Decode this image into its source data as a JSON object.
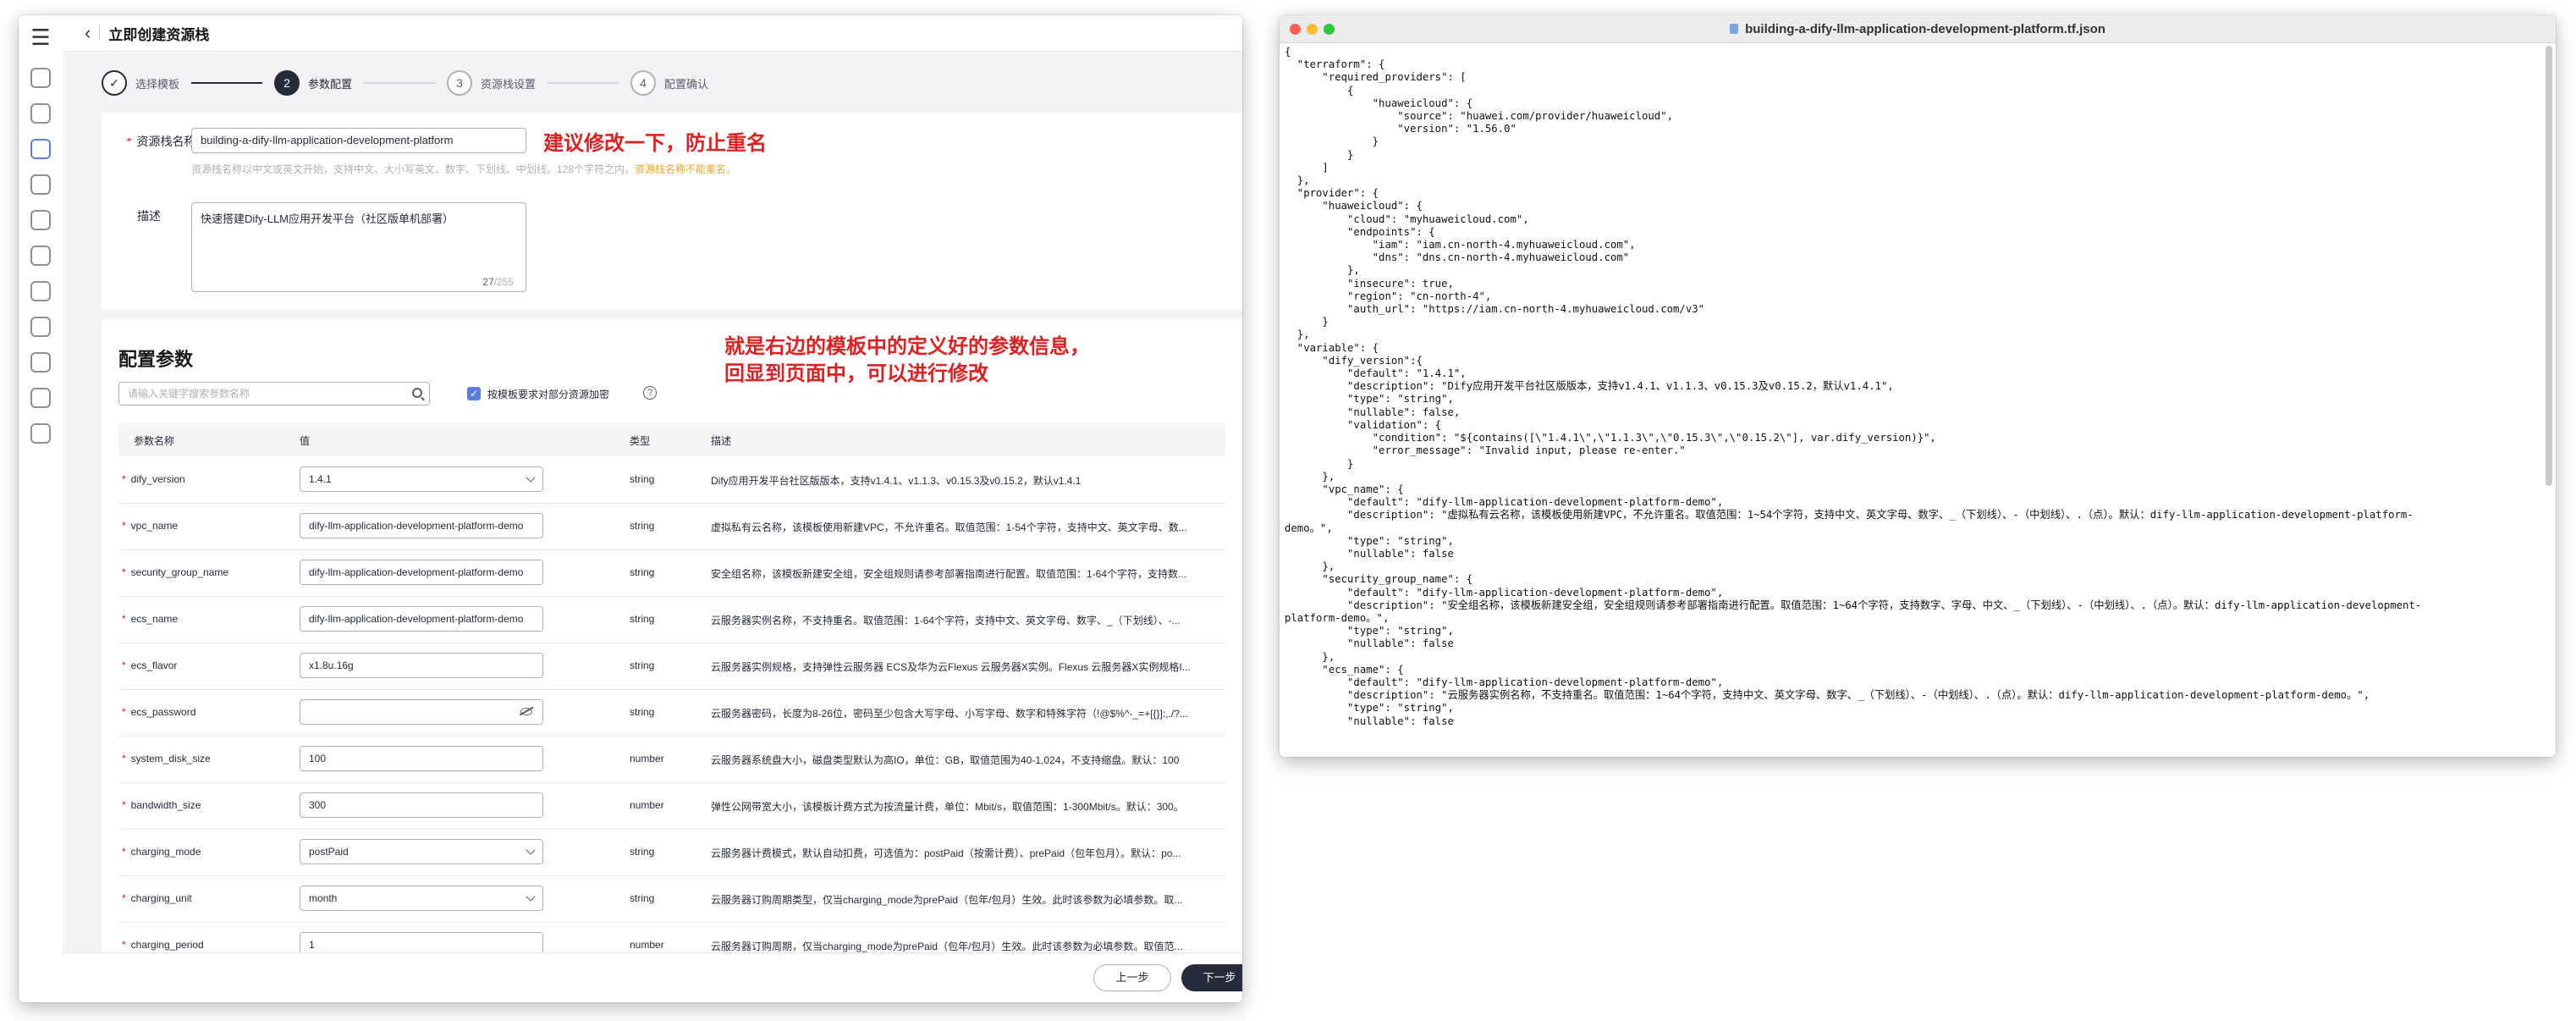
{
  "left_window": {
    "header": {
      "title": "立即创建资源栈"
    },
    "steps": [
      {
        "num": "",
        "label": "选择模板"
      },
      {
        "num": "2",
        "label": "参数配置"
      },
      {
        "num": "3",
        "label": "资源栈设置"
      },
      {
        "num": "4",
        "label": "配置确认"
      }
    ],
    "stack_name": {
      "label": "资源栈名称",
      "value": "building-a-dify-llm-application-development-platform",
      "hint": "资源栈名称以中文或英文开始，支持中文、大小写英文、数字、下划线、中划线。128个字符之内。",
      "hint_warn": "资源栈名称不能重名。"
    },
    "description": {
      "label": "描述",
      "value": "快速搭建Dify-LLM应用开发平台（社区版单机部署）",
      "count": "27",
      "total": "/255"
    },
    "annotation_top": "建议修改一下，防止重名",
    "annotation_mid_1": "就是右边的模板中的定义好的参数信息，",
    "annotation_mid_2": "回显到页面中，可以进行修改",
    "config": {
      "title": "配置参数",
      "search_placeholder": "请输入关键字搜索参数名称",
      "encrypt_label": "按模板要求对部分资源加密"
    },
    "table": {
      "headers": [
        "参数名称",
        "值",
        "类型",
        "描述"
      ],
      "rows": [
        {
          "name": "dify_version",
          "value": "1.4.1",
          "control": "select",
          "type": "string",
          "desc": "Dify应用开发平台社区版版本，支持v1.4.1、v1.1.3、v0.15.3及v0.15.2，默认v1.4.1"
        },
        {
          "name": "vpc_name",
          "value": "dify-llm-application-development-platform-demo",
          "control": "text",
          "type": "string",
          "desc": "虚拟私有云名称，该模板使用新建VPC，不允许重名。取值范围：1-54个字符，支持中文、英文字母、数..."
        },
        {
          "name": "security_group_name",
          "value": "dify-llm-application-development-platform-demo",
          "control": "text",
          "type": "string",
          "desc": "安全组名称，该模板新建安全组，安全组规则请参考部署指南进行配置。取值范围：1-64个字符，支持数..."
        },
        {
          "name": "ecs_name",
          "value": "dify-llm-application-development-platform-demo",
          "control": "text",
          "type": "string",
          "desc": "云服务器实例名称，不支持重名。取值范围：1-64个字符，支持中文、英文字母、数字、_（下划线）、-..."
        },
        {
          "name": "ecs_flavor",
          "value": "x1.8u.16g",
          "control": "text",
          "type": "string",
          "desc": "云服务器实例规格，支持弹性云服务器 ECS及华为云Flexus 云服务器X实例。Flexus 云服务器X实例规格I..."
        },
        {
          "name": "ecs_password",
          "value": "",
          "control": "password",
          "type": "string",
          "desc": "云服务器密码，长度为8-26位，密码至少包含大写字母、小写字母、数字和特殊字符（!@$%^-_=+[{}]:,./?..."
        },
        {
          "name": "system_disk_size",
          "value": "100",
          "control": "text",
          "type": "number",
          "desc": "云服务器系统盘大小，磁盘类型默认为高IO，单位：GB，取值范围为40-1,024，不支持缩盘。默认：100"
        },
        {
          "name": "bandwidth_size",
          "value": "300",
          "control": "text",
          "type": "number",
          "desc": "弹性公网带宽大小，该模板计费方式为按流量计费，单位：Mbit/s，取值范围：1-300Mbit/s。默认：300。"
        },
        {
          "name": "charging_mode",
          "value": "postPaid",
          "control": "select",
          "type": "string",
          "desc": "云服务器计费模式，默认自动扣费，可选值为：postPaid（按需计费）、prePaid（包年包月）。默认：po..."
        },
        {
          "name": "charging_unit",
          "value": "month",
          "control": "select",
          "type": "string",
          "desc": "云服务器订购周期类型，仅当charging_mode为prePaid（包年/包月）生效。此时该参数为必填参数。取..."
        },
        {
          "name": "charging_period",
          "value": "1",
          "control": "text",
          "type": "number",
          "desc": "云服务器订购周期，仅当charging_mode为prePaid（包年/包月）生效。此时该参数为必填参数。取值范..."
        }
      ]
    },
    "footer": {
      "prev_label": "上一步",
      "next_label": "下一步"
    }
  },
  "right_window": {
    "filename": "building-a-dify-llm-application-development-platform.tf.json",
    "code": "{\n  \"terraform\": {\n      \"required_providers\": [\n          {\n              \"huaweicloud\": {\n                  \"source\": \"huawei.com/provider/huaweicloud\",\n                  \"version\": \"1.56.0\"\n              }\n          }\n      ]\n  },\n  \"provider\": {\n      \"huaweicloud\": {\n          \"cloud\": \"myhuaweicloud.com\",\n          \"endpoints\": {\n              \"iam\": \"iam.cn-north-4.myhuaweicloud.com\",\n              \"dns\": \"dns.cn-north-4.myhuaweicloud.com\"\n          },\n          \"insecure\": true,\n          \"region\": \"cn-north-4\",\n          \"auth_url\": \"https://iam.cn-north-4.myhuaweicloud.com/v3\"\n      }\n  },\n  \"variable\": {\n      \"dify_version\":{\n          \"default\": \"1.4.1\",\n          \"description\": \"Dify应用开发平台社区版版本，支持v1.4.1、v1.1.3、v0.15.3及v0.15.2，默认v1.4.1\",\n          \"type\": \"string\",\n          \"nullable\": false,\n          \"validation\": {\n              \"condition\": \"${contains([\\\"1.4.1\\\",\\\"1.1.3\\\",\\\"0.15.3\\\",\\\"0.15.2\\\"], var.dify_version)}\",\n              \"error_message\": \"Invalid input, please re-enter.\"\n          }\n      },\n      \"vpc_name\": {\n          \"default\": \"dify-llm-application-development-platform-demo\",\n          \"description\": \"虚拟私有云名称，该模板使用新建VPC，不允许重名。取值范围：1~54个字符，支持中文、英文字母、数字、_（下划线）、-（中划线）、.（点）。默认：dify-llm-application-development-platform-\ndemo。\",\n          \"type\": \"string\",\n          \"nullable\": false\n      },\n      \"security_group_name\": {\n          \"default\": \"dify-llm-application-development-platform-demo\",\n          \"description\": \"安全组名称，该模板新建安全组，安全组规则请参考部署指南进行配置。取值范围：1~64个字符，支持数字、字母、中文、_（下划线）、-（中划线）、.（点）。默认：dify-llm-application-development-\nplatform-demo。\",\n          \"type\": \"string\",\n          \"nullable\": false\n      },\n      \"ecs_name\": {\n          \"default\": \"dify-llm-application-development-platform-demo\",\n          \"description\": \"云服务器实例名称，不支持重名。取值范围：1~64个字符，支持中文、英文字母、数字、_（下划线）、-（中划线）、.（点）。默认：dify-llm-application-development-platform-demo。\",\n          \"type\": \"string\",\n          \"nullable\": false"
  }
}
